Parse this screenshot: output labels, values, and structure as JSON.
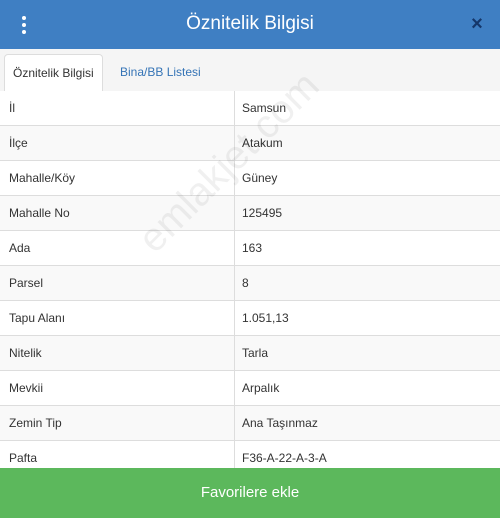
{
  "header": {
    "title": "Öznitelik Bilgisi",
    "close_symbol": "×"
  },
  "tabs": [
    {
      "label": "Öznitelik Bilgisi",
      "active": true
    },
    {
      "label": "Bina/BB Listesi",
      "active": false
    }
  ],
  "rows": [
    {
      "key": "İl",
      "value": "Samsun"
    },
    {
      "key": "İlçe",
      "value": "Atakum"
    },
    {
      "key": "Mahalle/Köy",
      "value": "Güney"
    },
    {
      "key": "Mahalle No",
      "value": "125495"
    },
    {
      "key": "Ada",
      "value": "163"
    },
    {
      "key": "Parsel",
      "value": "8"
    },
    {
      "key": "Tapu Alanı",
      "value": "1.051,13"
    },
    {
      "key": "Nitelik",
      "value": "Tarla"
    },
    {
      "key": "Mevkii",
      "value": "Arpalık"
    },
    {
      "key": "Zemin Tip",
      "value": "Ana Taşınmaz"
    },
    {
      "key": "Pafta",
      "value": "F36-A-22-A-3-A"
    }
  ],
  "watermark": "emlakjet.com",
  "footer": {
    "button_label": "Favorilere ekle"
  },
  "colors": {
    "header": "#3f7fc3",
    "button": "#5cb85c",
    "link": "#3574b6"
  }
}
